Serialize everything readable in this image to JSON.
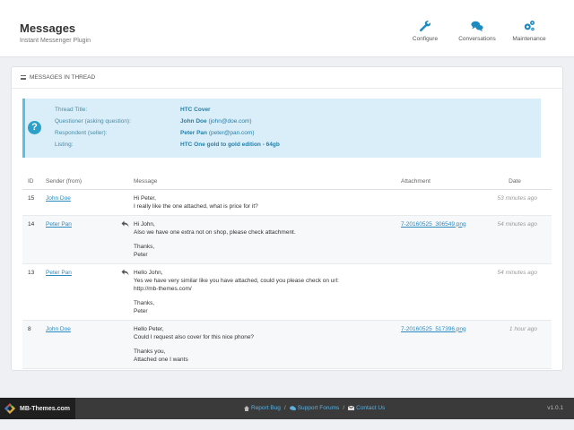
{
  "header": {
    "title": "Messages",
    "subtitle": "Instant Messenger Plugin",
    "tools": [
      {
        "label": "Configure",
        "icon": "wrench-icon"
      },
      {
        "label": "Conversations",
        "icon": "chat-bubbles-icon"
      },
      {
        "label": "Maintenance",
        "icon": "gears-icon"
      }
    ]
  },
  "panel": {
    "title": "MESSAGES IN THREAD"
  },
  "thread": {
    "title_label": "Thread Title:",
    "title_value": "HTC Cover",
    "questioner_label": "Questioner (asking question):",
    "questioner_name": "John Doe",
    "questioner_email": "(john@doe.com)",
    "respondent_label": "Respondent (seller):",
    "respondent_name": "Peter Pan",
    "respondent_email": "(peter@pan.com)",
    "listing_label": "Listing:",
    "listing_value": "HTC One gold to gold edition - 64gb"
  },
  "table": {
    "headers": {
      "id": "ID",
      "sender": "Sender (from)",
      "message": "Message",
      "attachment": "Attachment",
      "date": "Date"
    },
    "rows": [
      {
        "id": "15",
        "sender": "John Doe",
        "reply": false,
        "lines": [
          "Hi Peter,",
          "I really like the one attached, what is price for it?"
        ],
        "attachment": "",
        "date": "53 minutes ago"
      },
      {
        "id": "14",
        "sender": "Peter Pan",
        "reply": true,
        "lines": [
          "Hi John,",
          "Also we have one extra not on shop, please check attachment.",
          "",
          "Thanks,",
          "Peter"
        ],
        "attachment": "7-20160525_306549.png",
        "date": "54 minutes ago"
      },
      {
        "id": "13",
        "sender": "Peter Pan",
        "reply": true,
        "lines": [
          "Hello John,",
          "Yes we have very similar like you have attached, could you please check on url:",
          "http://mb-themes.com/",
          "",
          "Thanks,",
          "Peter"
        ],
        "attachment": "",
        "date": "54 minutes ago"
      },
      {
        "id": "8",
        "sender": "John Doe",
        "reply": false,
        "lines": [
          "Hello Peter,",
          "Could I request also cover for this nice phone?",
          "",
          "Thanks you,",
          "Attached one I wants"
        ],
        "attachment": "7-20160525_517396.png",
        "date": "1 hour ago"
      }
    ]
  },
  "footer": {
    "brand": "MB-Themes.com",
    "report_bug": "Report Bug",
    "support": "Support Forums",
    "contact": "Contact Us",
    "version": "v1.0.1"
  },
  "colors": {
    "accent": "#2ba1c9",
    "info_bg": "#d9eef8",
    "link": "#2a8ac0",
    "footer_bg": "#3a3a3a"
  }
}
